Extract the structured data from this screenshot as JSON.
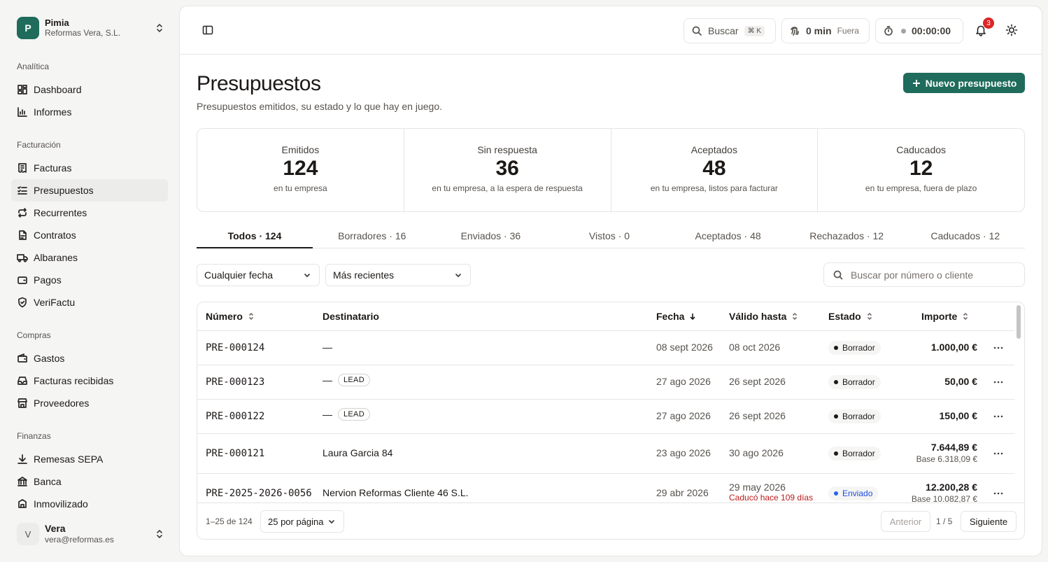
{
  "org": {
    "initial": "P",
    "name": "Pimia",
    "company": "Reformas Vera, S.L."
  },
  "nav": {
    "sections": [
      {
        "title": "Analítica",
        "items": [
          {
            "label": "Dashboard",
            "icon": "dashboard-icon"
          },
          {
            "label": "Informes",
            "icon": "chart-icon"
          }
        ]
      },
      {
        "title": "Facturación",
        "items": [
          {
            "label": "Facturas",
            "icon": "invoice-icon"
          },
          {
            "label": "Presupuestos",
            "icon": "list-check-icon",
            "active": true
          },
          {
            "label": "Recurrentes",
            "icon": "repeat-icon"
          },
          {
            "label": "Contratos",
            "icon": "contract-icon"
          },
          {
            "label": "Albaranes",
            "icon": "truck-icon"
          },
          {
            "label": "Pagos",
            "icon": "wallet-icon"
          },
          {
            "label": "VeriFactu",
            "icon": "shield-check-icon"
          }
        ]
      },
      {
        "title": "Compras",
        "items": [
          {
            "label": "Gastos",
            "icon": "purse-icon"
          },
          {
            "label": "Facturas recibidas",
            "icon": "inbox-icon"
          },
          {
            "label": "Proveedores",
            "icon": "store-icon"
          }
        ]
      },
      {
        "title": "Finanzas",
        "items": [
          {
            "label": "Remesas SEPA",
            "icon": "download-icon"
          },
          {
            "label": "Banca",
            "icon": "bank-icon"
          },
          {
            "label": "Inmovilizado",
            "icon": "asset-icon"
          }
        ]
      }
    ]
  },
  "user": {
    "initial": "V",
    "name": "Vera",
    "email": "vera@reformas.es"
  },
  "topbar": {
    "search_label": "Buscar",
    "search_kbd": "⌘ K",
    "time_value": "0 min",
    "time_status": "Fuera",
    "timer": "00:00:00",
    "notifications": "3"
  },
  "page": {
    "title": "Presupuestos",
    "subtitle": "Presupuestos emitidos, su estado y lo que hay en juego.",
    "new_button": "Nuevo presupuesto"
  },
  "stats": [
    {
      "label": "Emitidos",
      "value": "124",
      "note": "en tu empresa"
    },
    {
      "label": "Sin respuesta",
      "value": "36",
      "note": "en tu empresa, a la espera de respuesta"
    },
    {
      "label": "Aceptados",
      "value": "48",
      "note": "en tu empresa, listos para facturar"
    },
    {
      "label": "Caducados",
      "value": "12",
      "note": "en tu empresa, fuera de plazo"
    }
  ],
  "tabs": [
    "Todos · 124",
    "Borradores · 16",
    "Enviados · 36",
    "Vistos · 0",
    "Aceptados · 48",
    "Rechazados · 12",
    "Caducados · 12"
  ],
  "filters": {
    "date": "Cualquier fecha",
    "sort": "Más recientes",
    "search_placeholder": "Buscar por número o cliente"
  },
  "table": {
    "columns": {
      "number": "Número",
      "recipient": "Destinatario",
      "date": "Fecha",
      "valid": "Válido hasta",
      "status": "Estado",
      "amount": "Importe"
    },
    "rows": [
      {
        "number": "PRE-000124",
        "recipient": "—",
        "lead": "",
        "date": "08 sept 2026",
        "valid": "08 oct 2026",
        "note": "",
        "status": "Borrador",
        "amount": "1.000,00 €",
        "base": ""
      },
      {
        "number": "PRE-000123",
        "recipient": "—",
        "lead": "LEAD",
        "date": "27 ago 2026",
        "valid": "26 sept 2026",
        "note": "",
        "status": "Borrador",
        "amount": "50,00 €",
        "base": ""
      },
      {
        "number": "PRE-000122",
        "recipient": "—",
        "lead": "LEAD",
        "date": "27 ago 2026",
        "valid": "26 sept 2026",
        "note": "",
        "status": "Borrador",
        "amount": "150,00 €",
        "base": ""
      },
      {
        "number": "PRE-000121",
        "recipient": "Laura Garcia 84",
        "lead": "",
        "date": "23 ago 2026",
        "valid": "30 ago 2026",
        "note": "",
        "status": "Borrador",
        "amount": "7.644,89 €",
        "base": "Base 6.318,09 €"
      },
      {
        "number": "PRE-2025-2026-0056",
        "recipient": "Nervion Reformas Cliente 46 S.L.",
        "lead": "",
        "date": "29 abr 2026",
        "valid": "29 may 2026",
        "note": "Caducó hace 109 días",
        "status": "Enviado",
        "amount": "12.200,28 €",
        "base": "Base 10.082,87 €"
      }
    ]
  },
  "pagination": {
    "range": "1–25 de 124",
    "per_page": "25 por página",
    "prev": "Anterior",
    "page": "1 / 5",
    "next": "Siguiente"
  },
  "colors": {
    "accent": "#1f6b5c",
    "sent": "#2563eb",
    "expired": "#b91c1c",
    "badge": "#dc2626"
  }
}
